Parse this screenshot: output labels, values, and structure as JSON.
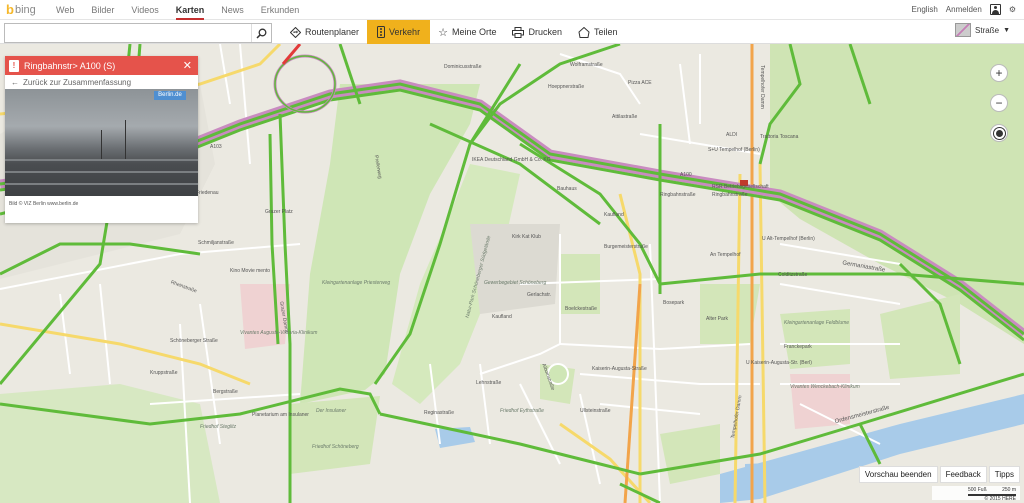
{
  "brand": {
    "name": "bing"
  },
  "nav": {
    "items": [
      "Web",
      "Bilder",
      "Videos",
      "Karten",
      "News",
      "Erkunden"
    ],
    "active": "Karten"
  },
  "topright": {
    "language": "English",
    "signin": "Anmelden"
  },
  "toolbar": {
    "search_value": "",
    "tools": [
      "Routenplaner",
      "Verkehr",
      "Meine Orte",
      "Drucken",
      "Teilen"
    ],
    "active_tool": "Verkehr",
    "map_style": "Straße"
  },
  "panel": {
    "title": "Ringbahnstr> A100 (S)",
    "back": "Zurück zur Zusammenfassung",
    "cam_badge": "Berlin.de",
    "caption": "Bild © VIZ Berlin www.berlin.de"
  },
  "controls": {
    "zoom_in": "+",
    "zoom_out": "−"
  },
  "bottom": {
    "buttons": [
      "Vorschau beenden",
      "Feedback",
      "Tipps"
    ],
    "scale_feet": "500 Fuß",
    "scale_m": "250 m",
    "copyright": "© 2015 HERE"
  },
  "map_labels": {
    "a100": "A100",
    "a103": "A103",
    "a100b": "A100",
    "ringbahn1": "Ringbahnstraße",
    "ringbahn2": "Ringbahnstraße",
    "tempelhofer_damm": "Tempelhofer Damm",
    "tempelhofer_damm2": "Tempelhofer Damm",
    "friedenau": "Friedenau",
    "grazer_platz": "Grazer Platz",
    "grazer_damm": "Grazer Damm",
    "bergstrasse": "Bergstraße",
    "prellerweg": "Prellerweg",
    "schoeneberg": "Schöneberg",
    "priesterweg": "Kleingartenanlage Priesterweg",
    "naturpark": "Natur-Park Schöneberger Südgelände",
    "ikea": "IKEA Deutschland GmbH & Co. KG",
    "bauhaus": "Bauhaus",
    "kaufland1": "Kaufland",
    "kaufland2": "Kaufland",
    "burgemeister": "Burgemeisterstraße",
    "gewerbegebiet": "Gewerbegebiet Schöneberg",
    "alboinstr": "Alboinstraße",
    "eythstr": "Eythstraße",
    "lyckstr": "Friedhof Eythstraße",
    "boelckestr": "Boelckestraße",
    "kaiserin": "Kaiserin-Augusta-Straße",
    "ufa": "Ullsteinstraße",
    "alt_tempelhof": "U Alt-Tempelhof (Berlin)",
    "u_tempelhof": "S+U Tempelhof (Berlin)",
    "u_kaiserin": "U Kaiserin-Augusta-Str. (Berl)",
    "germaniastr": "Germaniastraße",
    "gottlieb": "Gottlieb-Dunkel-Str.",
    "bosepark": "Bosepark",
    "alter_park": "Alter Park",
    "franckepark": "Franckepark",
    "feldblume": "Kleingartenanlage Feldblume",
    "vivantes": "Vivantes Wenckebach-Klinikum",
    "vivantes2": "Vivantes Auguste-Viktoria-Klinikum",
    "friedhof": "Friedhof Steglitz",
    "planetarium": "Planetarium am Insulaner",
    "insulaner": "Der Insulaner",
    "friedhof_schoen": "Friedhof Schöneberg",
    "ordensmeister": "Ordensmeisterstraße",
    "aldi": "ALDI",
    "trattoria": "Trattoria Toscana",
    "pizza": "Pizza ACE",
    "rsr": "RSR Betriebsgesellschaft",
    "attila": "Attilastraße",
    "mariendorf": "Mariendorfer Damm",
    "kino": "Kino Movie mento",
    "dominicus": "Dominicusstraße",
    "hoeppner": "Hoeppnerstraße",
    "wolframstr": "Wolframstraße",
    "manfred": "Manfred-von-Richthofen-Str.",
    "rheinstr": "Rheinstraße",
    "schmiljan": "Schmiljanstraße",
    "schoenebergerstr": "Schöneberger Straße",
    "colditz": "Colditzstraße",
    "an_tempelhof": "An Tempelhof",
    "bundesring": "Bundesring",
    "kirk": "Kirk Kat Klub",
    "gerlach": "Gerlachstr.",
    "regina": "Reginastraße",
    "lehnstr": "Lehnstraße",
    "kruppstr": "Kruppstraße"
  }
}
